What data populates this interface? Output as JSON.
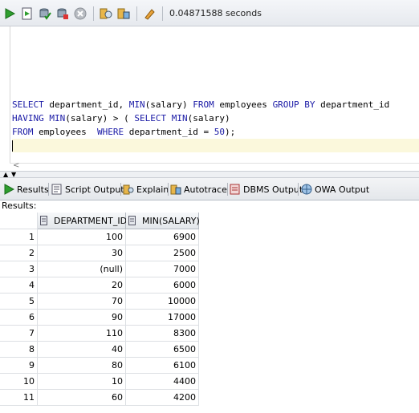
{
  "toolbar": {
    "elapsed": "0.04871588 seconds",
    "buttons": [
      "run-statement",
      "run-script",
      "commit",
      "rollback",
      "cancel",
      "explain-plan",
      "autotrace",
      "clear"
    ]
  },
  "editor": {
    "lines": [
      [
        [
          "kw",
          "SELECT"
        ],
        [
          "t",
          " department_id, "
        ],
        [
          "kw",
          "MIN"
        ],
        [
          "t",
          "(salary) "
        ],
        [
          "kw",
          "FROM"
        ],
        [
          "t",
          " employees "
        ],
        [
          "kw",
          "GROUP BY"
        ],
        [
          "t",
          " department_id"
        ]
      ],
      [
        [
          "kw",
          "HAVING"
        ],
        [
          "t",
          " "
        ],
        [
          "kw",
          "MIN"
        ],
        [
          "t",
          "(salary) > ( "
        ],
        [
          "kw",
          "SELECT"
        ],
        [
          "t",
          " "
        ],
        [
          "kw",
          "MIN"
        ],
        [
          "t",
          "(salary)"
        ]
      ],
      [
        [
          "kw",
          "FROM"
        ],
        [
          "t",
          " employees  "
        ],
        [
          "kw",
          "WHERE"
        ],
        [
          "t",
          " department_id = "
        ],
        [
          "num",
          "50"
        ],
        [
          "t",
          ");"
        ]
      ]
    ]
  },
  "tabs": [
    {
      "label": "Results",
      "icon": "run-icon"
    },
    {
      "label": "Script Output",
      "icon": "script-output-icon"
    },
    {
      "label": "Explain",
      "icon": "explain-icon"
    },
    {
      "label": "Autotrace",
      "icon": "autotrace-icon"
    },
    {
      "label": "DBMS Output",
      "icon": "dbms-output-icon"
    },
    {
      "label": "OWA Output",
      "icon": "owa-output-icon"
    }
  ],
  "results_label": "Results:",
  "grid": {
    "columns": [
      "DEPARTMENT_ID",
      "MIN(SALARY)"
    ],
    "rows": [
      [
        "1",
        "100",
        "6900"
      ],
      [
        "2",
        "30",
        "2500"
      ],
      [
        "3",
        "(null)",
        "7000"
      ],
      [
        "4",
        "20",
        "6000"
      ],
      [
        "5",
        "70",
        "10000"
      ],
      [
        "6",
        "90",
        "17000"
      ],
      [
        "7",
        "110",
        "8300"
      ],
      [
        "8",
        "40",
        "6500"
      ],
      [
        "9",
        "80",
        "6100"
      ],
      [
        "10",
        "10",
        "4400"
      ],
      [
        "11",
        "60",
        "4200"
      ]
    ]
  }
}
